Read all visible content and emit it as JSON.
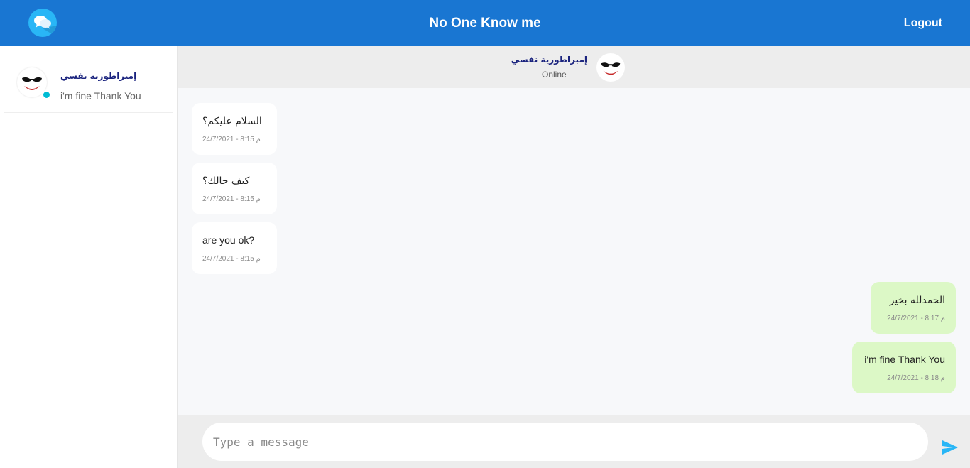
{
  "app": {
    "title": "No One Know me",
    "logout_label": "Logout",
    "accent_color": "#1976d2",
    "logo_icon": "chat-bubbles-icon"
  },
  "sidebar": {
    "contacts": [
      {
        "name": "إمبراطورية نفسي",
        "last_message": "i'm fine Thank You",
        "online": true,
        "avatar_icon": "joker-avatar"
      }
    ]
  },
  "chat": {
    "header": {
      "name": "إمبراطورية نفسي",
      "status": "Online",
      "avatar_icon": "joker-avatar"
    },
    "messages": [
      {
        "direction": "in",
        "text": "السلام عليكم؟",
        "time": "24/7/2021 - 8:15 م"
      },
      {
        "direction": "in",
        "text": "كيف حالك؟",
        "time": "24/7/2021 - 8:15 م"
      },
      {
        "direction": "in",
        "text": "are you ok?",
        "time": "24/7/2021 - 8:15 م"
      },
      {
        "direction": "out",
        "text": "الحمدلله بخير",
        "time": "24/7/2021 - 8:17 م"
      },
      {
        "direction": "out",
        "text": "i'm fine Thank You",
        "time": "24/7/2021 - 8:18 م"
      }
    ],
    "composer": {
      "placeholder": "Type a message",
      "send_icon": "send-icon"
    },
    "colors": {
      "incoming_bubble": "#ffffff",
      "outgoing_bubble": "#dcf8c6",
      "online_dot": "#00bcd4"
    }
  }
}
